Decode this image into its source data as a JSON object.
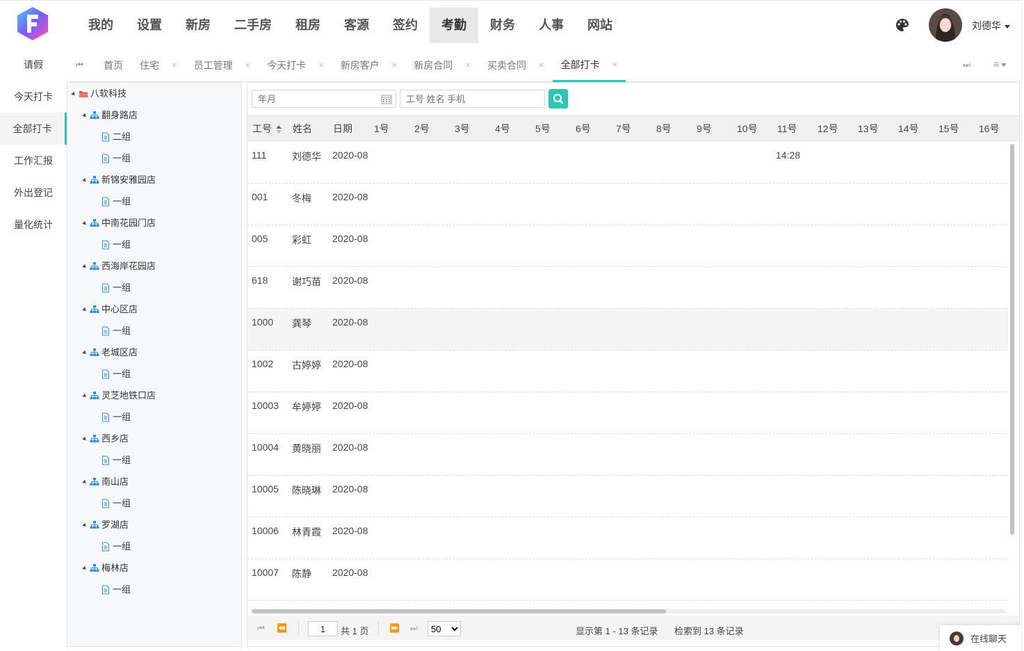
{
  "main_nav": [
    "我的",
    "设置",
    "新房",
    "二手房",
    "租房",
    "客源",
    "签约",
    "考勤",
    "财务",
    "人事",
    "网站"
  ],
  "main_nav_active": "考勤",
  "user": {
    "name": "刘德华"
  },
  "sub_nav": [
    "请假",
    "今天打卡",
    "全部打卡",
    "工作汇报",
    "外出登记",
    "量化统计"
  ],
  "sub_nav_active": "全部打卡",
  "tabs": [
    {
      "label": "首页",
      "closable": false
    },
    {
      "label": "住宅",
      "closable": true
    },
    {
      "label": "员工管理",
      "closable": true
    },
    {
      "label": "今天打卡",
      "closable": true
    },
    {
      "label": "新房客户",
      "closable": true
    },
    {
      "label": "新房合同",
      "closable": true
    },
    {
      "label": "买卖合同",
      "closable": true
    },
    {
      "label": "全部打卡",
      "closable": true
    }
  ],
  "tab_active": "全部打卡",
  "tree": {
    "root": "八软科技",
    "stores": [
      {
        "name": "翻身路店",
        "groups": [
          "二组",
          "一组"
        ]
      },
      {
        "name": "新锦安雅园店",
        "groups": [
          "一组"
        ]
      },
      {
        "name": "中南花园门店",
        "groups": [
          "一组"
        ]
      },
      {
        "name": "西海岸花园店",
        "groups": [
          "一组"
        ]
      },
      {
        "name": "中心区店",
        "groups": [
          "一组"
        ]
      },
      {
        "name": "老城区店",
        "groups": [
          "一组"
        ]
      },
      {
        "name": "灵芝地铁口店",
        "groups": [
          "一组"
        ]
      },
      {
        "name": "西乡店",
        "groups": [
          "一组"
        ]
      },
      {
        "name": "南山店",
        "groups": [
          "一组"
        ]
      },
      {
        "name": "罗湖店",
        "groups": [
          "一组"
        ]
      },
      {
        "name": "梅林店",
        "groups": [
          "一组"
        ]
      }
    ]
  },
  "search": {
    "month_placeholder": "年月",
    "keyword_placeholder": "工号 姓名 手机"
  },
  "grid": {
    "columns": [
      "工号",
      "姓名",
      "日期",
      "1号",
      "2号",
      "3号",
      "4号",
      "5号",
      "6号",
      "7号",
      "8号",
      "9号",
      "10号",
      "11号",
      "12号",
      "13号",
      "14号",
      "15号",
      "16号"
    ],
    "rows": [
      {
        "id": "111",
        "name": "刘德华",
        "date": "2020-08",
        "day11": "14:28"
      },
      {
        "id": "001",
        "name": "冬梅",
        "date": "2020-08",
        "day11": ""
      },
      {
        "id": "005",
        "name": "彩虹",
        "date": "2020-08",
        "day11": ""
      },
      {
        "id": "618",
        "name": "谢巧苗",
        "date": "2020-08",
        "day11": ""
      },
      {
        "id": "1000",
        "name": "龚琴",
        "date": "2020-08",
        "day11": ""
      },
      {
        "id": "1002",
        "name": "古婷婷",
        "date": "2020-08",
        "day11": ""
      },
      {
        "id": "10003",
        "name": "牟婷婷",
        "date": "2020-08",
        "day11": ""
      },
      {
        "id": "10004",
        "name": "黄晓丽",
        "date": "2020-08",
        "day11": ""
      },
      {
        "id": "10005",
        "name": "陈晓琳",
        "date": "2020-08",
        "day11": ""
      },
      {
        "id": "10006",
        "name": "林青霞",
        "date": "2020-08",
        "day11": ""
      },
      {
        "id": "10007",
        "name": "陈静",
        "date": "2020-08",
        "day11": ""
      }
    ]
  },
  "pager": {
    "page": "1",
    "total_pages": "共 1 页",
    "page_size": "50",
    "page_size_options": [
      "50"
    ],
    "display": "显示第 1 - 13 条记录",
    "found": "检索到 13 条记录"
  },
  "chat": {
    "label": "在线聊天"
  },
  "colors": {
    "accent": "#2ec4b6",
    "tree_bg": "#f7f8fa",
    "folder_red": "#e8554e",
    "org_blue": "#2f8fde"
  },
  "icons": [
    "logo-f-icon",
    "palette-icon",
    "caret-down-icon",
    "first-tab-icon",
    "last-tab-icon",
    "tab-menu-icon",
    "close-icon",
    "folder-icon",
    "org-icon",
    "page-icon",
    "calendar-icon",
    "search-icon",
    "sort-icon",
    "first-page-icon",
    "prev-page-icon",
    "next-page-icon",
    "last-page-icon"
  ]
}
